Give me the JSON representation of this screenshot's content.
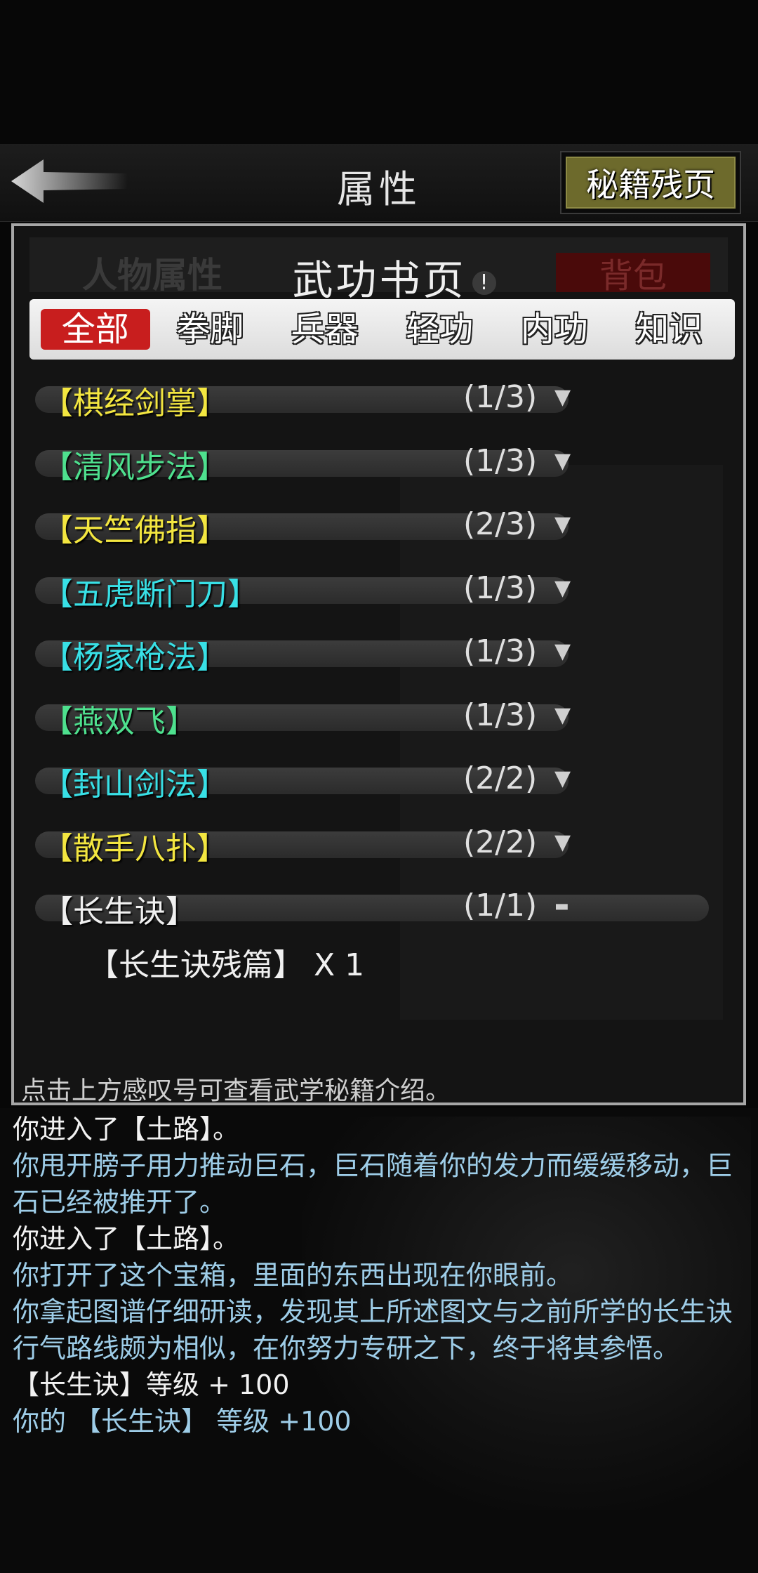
{
  "topbar": {
    "title": "属性",
    "fragments_button": "秘籍残页"
  },
  "panel": {
    "tab_attributes": "人物属性",
    "heading": "武功书页",
    "info_icon": "!",
    "tab_bag": "背包",
    "categories": [
      {
        "label": "全部",
        "active": true
      },
      {
        "label": "拳脚",
        "active": false
      },
      {
        "label": "兵器",
        "active": false
      },
      {
        "label": "轻功",
        "active": false
      },
      {
        "label": "内功",
        "active": false
      },
      {
        "label": "知识",
        "active": false
      }
    ],
    "items": [
      {
        "name": "【棋经剑掌】",
        "count": "(1/3)",
        "color": "#f3e640"
      },
      {
        "name": "【清风步法】",
        "count": "(1/3)",
        "color": "#4ee08e"
      },
      {
        "name": "【天竺佛指】",
        "count": "(2/3)",
        "color": "#f3e640"
      },
      {
        "name": "【五虎断门刀】",
        "count": "(1/3)",
        "color": "#38e0e6"
      },
      {
        "name": "【杨家枪法】",
        "count": "(1/3)",
        "color": "#38e0e6"
      },
      {
        "name": "【燕双飞】",
        "count": "(1/3)",
        "color": "#4ee08e"
      },
      {
        "name": "【封山剑法】",
        "count": "(2/2)",
        "color": "#38e0e6"
      },
      {
        "name": "【散手八扑】",
        "count": "(2/2)",
        "color": "#f3e640"
      },
      {
        "name": "【长生诀】",
        "count": "(1/1)",
        "color": "#f0f0f0"
      }
    ],
    "sub_item": "【长生诀残篇】 X 1",
    "hint": "点击上方感叹号可查看武学秘籍介绍。"
  },
  "log": [
    {
      "text": "你进入了【土路】。",
      "white": true
    },
    {
      "text": "你甩开膀子用力推动巨石，巨石随着你的发力而缓缓移动，巨石已经被推开了。",
      "white": false
    },
    {
      "text": "你进入了【土路】。",
      "white": true
    },
    {
      "text": "你打开了这个宝箱，里面的东西出现在你眼前。",
      "white": false
    },
    {
      "text": "你拿起图谱仔细研读，发现其上所述图文与之前所学的长生诀行气路线颇为相似，在你努力专研之下，终于将其参悟。",
      "white": false
    },
    {
      "text": "【长生诀】等级 + 100",
      "white": true
    },
    {
      "text": "你的 【长生诀】 等级 +100",
      "white": false
    }
  ]
}
